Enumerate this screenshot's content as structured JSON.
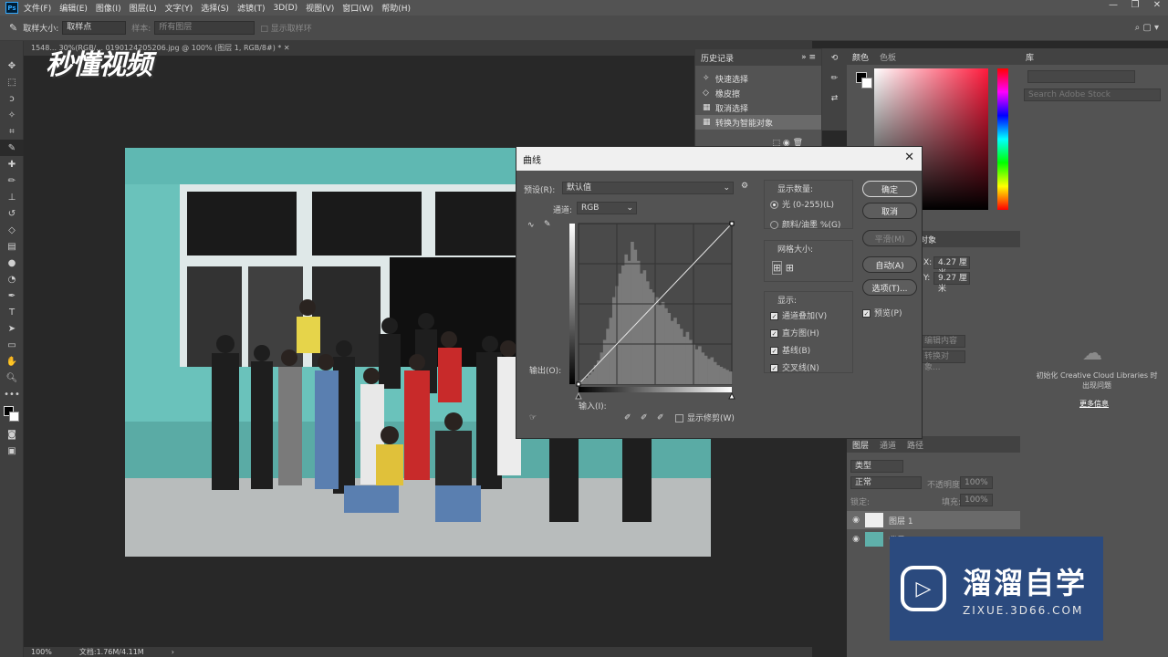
{
  "menubar": {
    "logo": "Ps",
    "items": [
      "文件(F)",
      "编辑(E)",
      "图像(I)",
      "图层(L)",
      "文字(Y)",
      "选择(S)",
      "滤镜(T)",
      "3D(D)",
      "视图(V)",
      "窗口(W)",
      "帮助(H)"
    ]
  },
  "options": {
    "sample_size_label": "取样大小:",
    "sample_size_value": "取样点",
    "sample_label": "样本:",
    "sample_value": "所有图层",
    "show_ring": "显示取样环"
  },
  "document": {
    "tab_title": "1548... 30%(RGB/... 0190124205206.jpg @ 100% (图层 1, RGB/8#) *",
    "zoom": "100%",
    "doc_size": "文档:1.76M/4.11M"
  },
  "history": {
    "tab": "历史记录",
    "items": [
      {
        "label": "快速选择",
        "icon": "quick-select-icon"
      },
      {
        "label": "橡皮擦",
        "icon": "eraser-icon"
      },
      {
        "label": "取消选择",
        "icon": "deselect-icon"
      },
      {
        "label": "转换为智能对象",
        "icon": "smart-object-icon"
      }
    ]
  },
  "color_panel": {
    "tabs": [
      "颜色",
      "色板"
    ],
    "foreground": "#000000",
    "background": "#ffffff"
  },
  "library": {
    "tab": "库",
    "search_placeholder": "Search Adobe Stock",
    "message": "初始化 Creative Cloud Libraries 时出现问题",
    "more_info": "更多信息"
  },
  "properties": {
    "tab_partial": "对象",
    "w_label": "X:",
    "w_value": "4.27 厘米",
    "h_label": "Y:",
    "h_value": "9.27 厘米",
    "ops": [
      "编辑内容",
      "转换对象..."
    ]
  },
  "layers": {
    "tabs": [
      "图层",
      "通道",
      "路径"
    ],
    "filter": "类型",
    "blend": "正常",
    "opacity_label": "不透明度:",
    "opacity": "100%",
    "lock_label": "锁定:",
    "fill_label": "填充:",
    "fill": "100%",
    "items": [
      {
        "name": "图层 1",
        "visible": true
      },
      {
        "name": "背景",
        "visible": true
      }
    ]
  },
  "curves": {
    "title": "曲线",
    "preset_label": "预设(R):",
    "preset_value": "默认值",
    "channel_label": "通道:",
    "channel_value": "RGB",
    "output_label": "输出(O):",
    "input_label": "输入(I):",
    "show_clipping": "显示修剪(W)",
    "show_amount_label": "显示数量:",
    "opt_light": "光 (0-255)(L)",
    "opt_pigment": "颜料/油墨 %(G)",
    "grid_size_label": "网格大小:",
    "show_label": "显示:",
    "show_channel_overlays": "通道叠加(V)",
    "show_histogram": "直方图(H)",
    "show_baseline": "基线(B)",
    "show_intersection": "交叉线(N)",
    "preview": "预览(P)",
    "buttons": {
      "ok": "确定",
      "cancel": "取消",
      "smooth": "平滑(M)",
      "auto": "自动(A)",
      "options": "选项(T)..."
    },
    "histogram": [
      2,
      3,
      4,
      6,
      8,
      12,
      15,
      20,
      28,
      35,
      42,
      55,
      62,
      70,
      75,
      82,
      78,
      90,
      85,
      78,
      70,
      72,
      65,
      60,
      58,
      55,
      50,
      52,
      48,
      45,
      40,
      42,
      38,
      35,
      30,
      33,
      28,
      25,
      22,
      24,
      20,
      18,
      16,
      17,
      14,
      12,
      11,
      10,
      9,
      8
    ]
  },
  "watermarks": {
    "top_left": "秒懂视频",
    "br_main": "溜溜自学",
    "br_sub": "ZIXUE.3D66.COM"
  }
}
